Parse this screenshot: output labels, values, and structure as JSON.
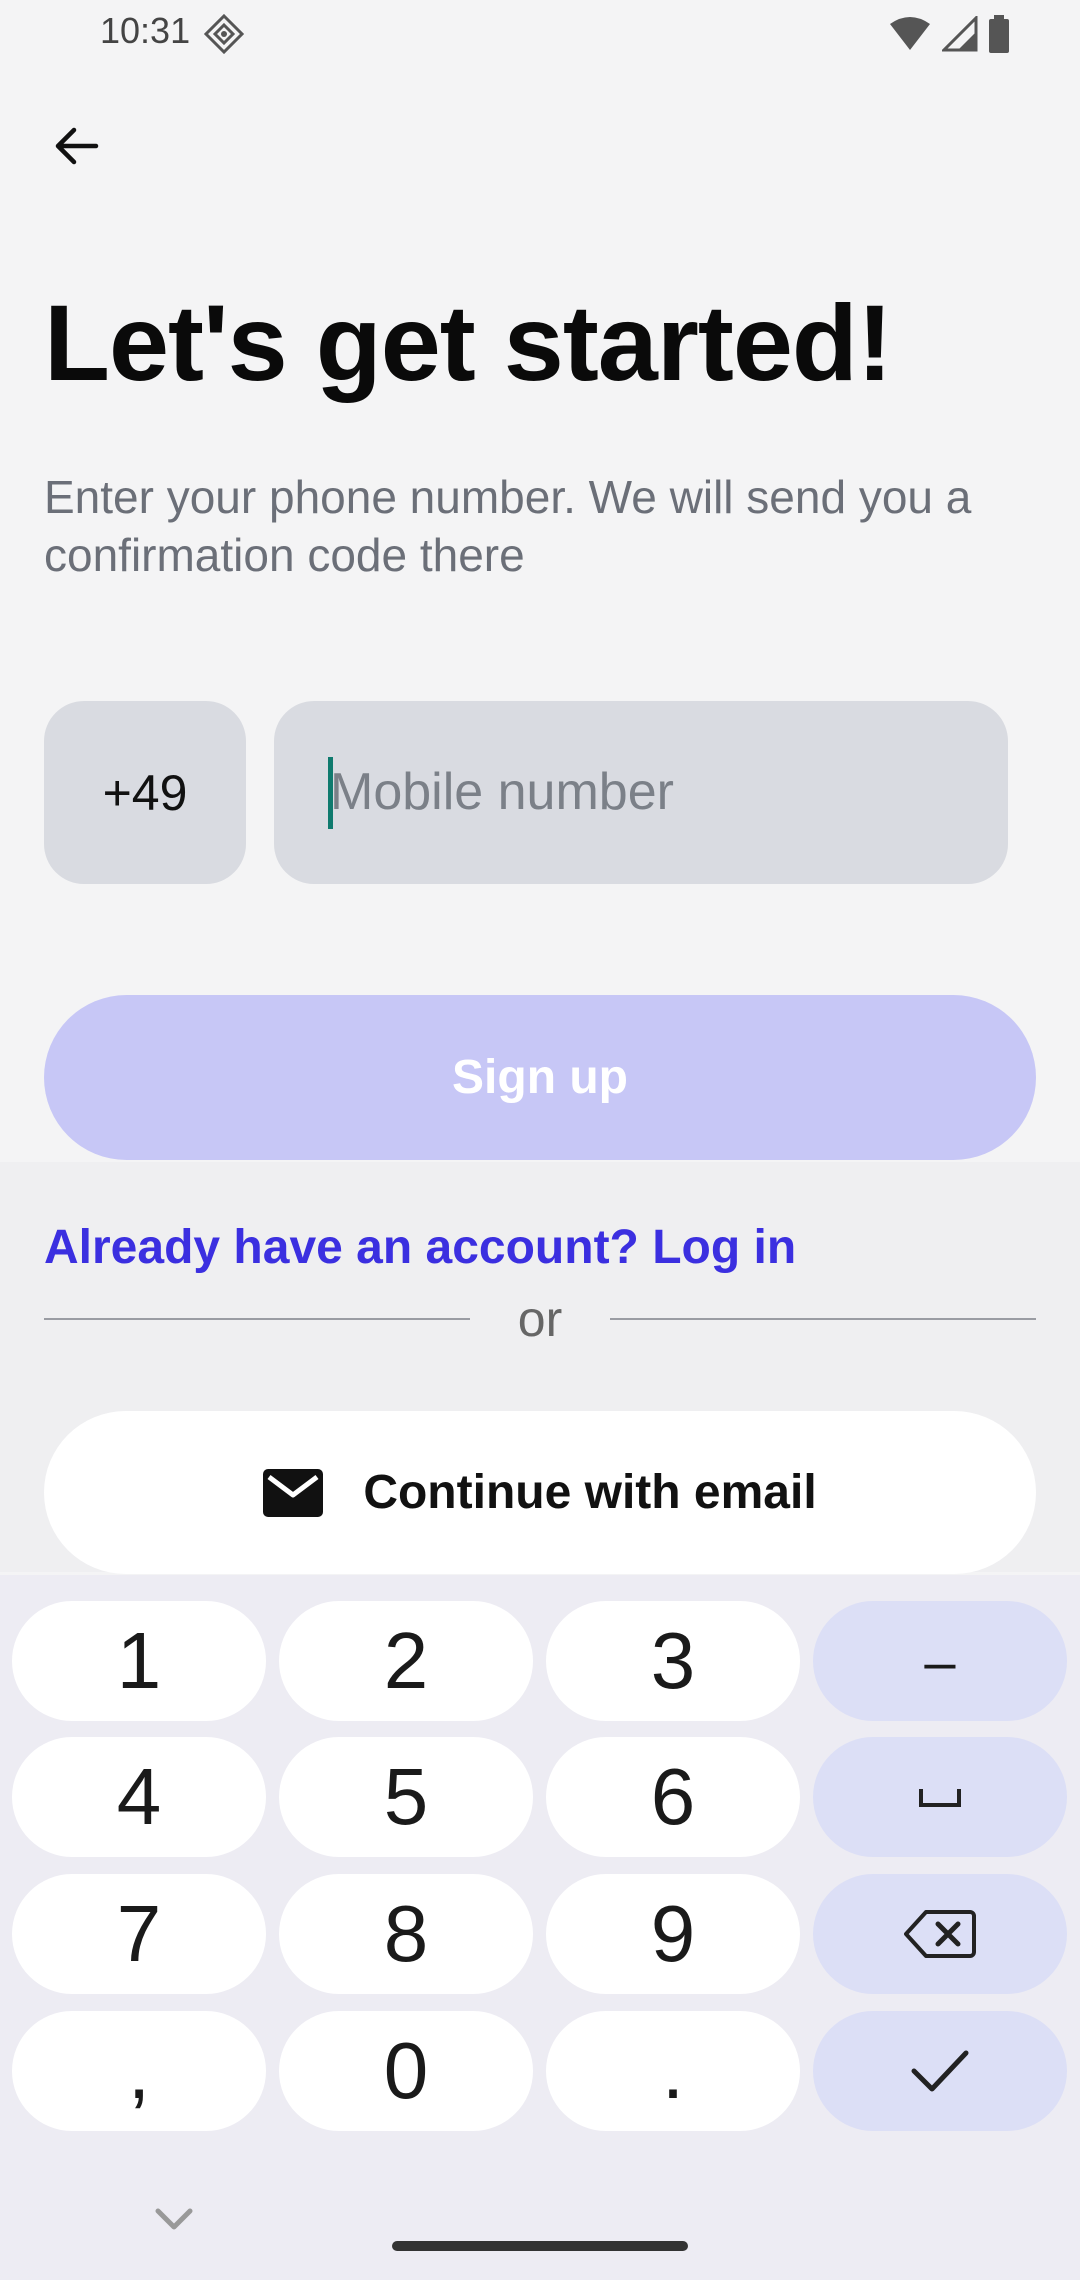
{
  "status_bar": {
    "time": "10:31"
  },
  "header": {
    "back_icon": "arrow-left-icon"
  },
  "main": {
    "title": "Let's get started!",
    "subtitle": "Enter your phone number. We will send you a confirmation code there",
    "country_code": "+49",
    "phone_input": {
      "value": "",
      "placeholder": "Mobile number"
    },
    "signup_label": "Sign up",
    "login_link": "Already have an account? Log in",
    "or_label": "or",
    "email_button": {
      "label": "Continue with email",
      "icon": "mail-icon"
    }
  },
  "keyboard": {
    "keys": [
      "1",
      "2",
      "3",
      "–",
      "4",
      "5",
      "6",
      "␣",
      "7",
      "8",
      "9",
      "backspace",
      ",",
      "0",
      ".",
      "done"
    ]
  },
  "colors": {
    "accent": "#3b2fe0",
    "signup_disabled": "#c7c7f6",
    "input_bg": "#d9dbe1"
  }
}
